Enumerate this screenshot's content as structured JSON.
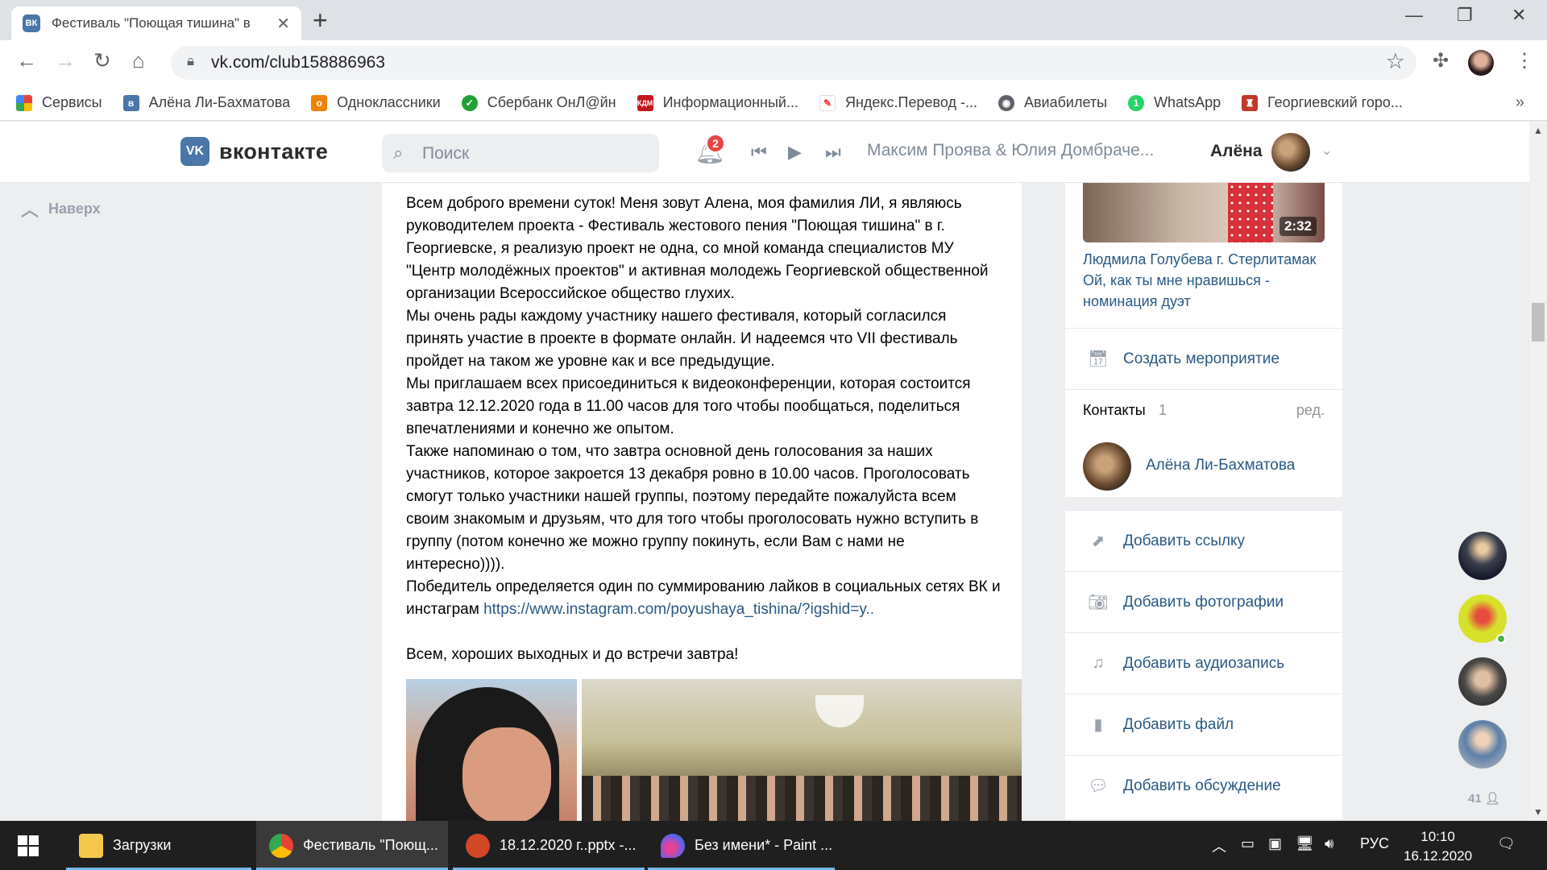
{
  "browser": {
    "tab_title": "Фестиваль \"Поющая тишина\" в",
    "tab_favicon": "ВК",
    "url": "vk.com/club158886963",
    "bookmarks": [
      {
        "label": "Сервисы",
        "icon": "apps-grid-icon",
        "color": "#ea4335"
      },
      {
        "label": "Алёна Ли-Бахматова",
        "icon": "vk-icon",
        "color": "#4a76a8"
      },
      {
        "label": "Одноклассники",
        "icon": "ok-icon",
        "color": "#ee8208"
      },
      {
        "label": "Сбербанк ОнЛ@йн",
        "icon": "sber-icon",
        "color": "#21a038"
      },
      {
        "label": "Информационный...",
        "icon": "kdm-icon",
        "color": "#c4161c"
      },
      {
        "label": "Яндекс.Перевод -...",
        "icon": "yandex-translate-icon",
        "color": "#f33"
      },
      {
        "label": "Авиабилеты",
        "icon": "globe-icon",
        "color": "#5f6368"
      },
      {
        "label": "WhatsApp",
        "icon": "whatsapp-icon",
        "color": "#25d366"
      },
      {
        "label": "Георгиевский горо...",
        "icon": "coat-of-arms-icon",
        "color": "#c0392b"
      }
    ]
  },
  "vk": {
    "logo_text": "вконтакте",
    "logo_mark": "VK",
    "search_placeholder": "Поиск",
    "notifications_count": "2",
    "now_playing": "Максим Проява & Юлия Домбраче...",
    "user_name": "Алёна",
    "up_link": "Наверх"
  },
  "post": {
    "paragraphs": [
      "Всем доброго времени суток! Меня зовут Алена, моя фамилия ЛИ, я являюсь руководителем проекта - Фестиваль жестового пения \"Поющая тишина\" в г. Георгиевске, я реализую проект не одна, со мной команда специалистов МУ \"Центр молодёжных проектов\" и активная молодежь Георгиевской общественной организации Всероссийское общество глухих.",
      "Мы очень рады каждому участнику нашего фестиваля, который согласился принять участие в проекте в формате онлайн. И надеемся что VII фестиваль пройдет на таком же уровне как и все предыдущие.",
      "Мы приглашаем всех присоединиться к видеоконференции, которая состоится завтра 12.12.2020 года в 11.00 часов для того чтобы пообщаться, поделиться впечатлениями и конечно же опытом.",
      "Также напоминаю о том, что завтра основной день голосования за наших участников, которое закроется 13 декабря ровно в 10.00 часов. Проголосовать смогут только участники нашей группы, поэтому передайте пожалуйста всем своим знакомым и друзьям, что для того чтобы проголосовать нужно вступить в группу (потом конечно же можно группу покинуть, если Вам с нами не интересно))))."
    ],
    "winner_text": "Победитель определяется один по суммированию лайков в социальных сетях ВК и инстаграм ",
    "link": "https://www.instagram.com/poyushaya_tishina/?igshid=y..",
    "closing": "Всем, хороших выходных и до встречи завтра!"
  },
  "sidebar": {
    "video_duration": "2:32",
    "video_title": "Людмила Голубева г. Стерлитамак Ой, как ты мне нравишься - номинация дуэт",
    "create_event": "Создать мероприятие",
    "contacts_label": "Контакты",
    "contacts_count": "1",
    "contacts_edit": "ред.",
    "contact_name": "Алёна Ли-Бахматова",
    "actions": [
      {
        "label": "Добавить ссылку",
        "icon": "link-icon"
      },
      {
        "label": "Добавить фотографии",
        "icon": "camera-icon"
      },
      {
        "label": "Добавить аудиозапись",
        "icon": "music-note-icon"
      },
      {
        "label": "Добавить файл",
        "icon": "file-icon"
      },
      {
        "label": "Добавить обсуждение",
        "icon": "discussion-icon"
      }
    ],
    "friends_online_count": "41"
  },
  "taskbar": {
    "items": [
      {
        "label": "Загрузки",
        "icon": "folder-icon",
        "color": "#f2c94c"
      },
      {
        "label": "Фестиваль \"Поющ...",
        "icon": "chrome-icon",
        "color": "#34a853"
      },
      {
        "label": "18.12.2020 г..pptx -...",
        "icon": "powerpoint-icon",
        "color": "#d24726"
      },
      {
        "label": "Без имени* - Paint ...",
        "icon": "paint-icon",
        "color": "#6c5ce7"
      }
    ],
    "language": "РУС",
    "time": "10:10",
    "date": "16.12.2020"
  }
}
